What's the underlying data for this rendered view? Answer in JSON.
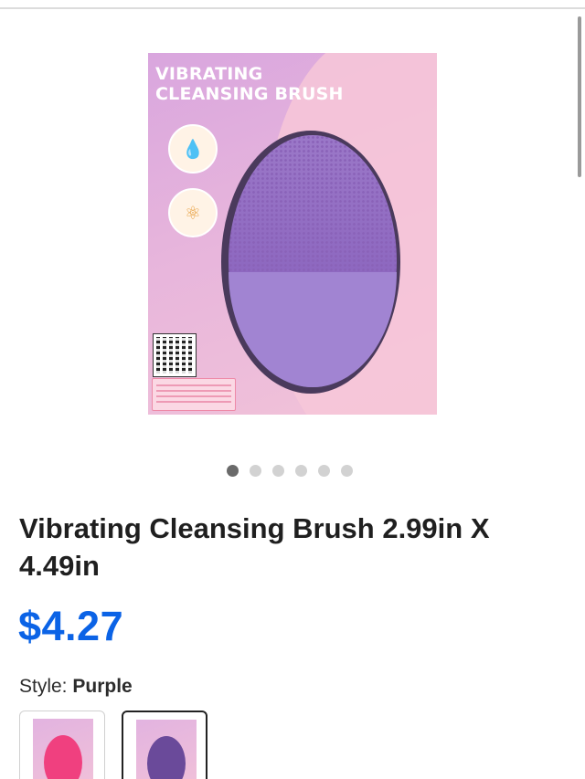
{
  "product": {
    "image_alt": "Vibrating Cleansing Brush package",
    "package_title_line1": "VIBRATING",
    "package_title_line2": "CLEANSING BRUSH",
    "title": "Vibrating Cleansing Brush 2.99in X 4.49in",
    "price": "$4.27",
    "style_label": "Style:",
    "style_value": "Purple"
  },
  "carousel": {
    "count": 6,
    "active_index": 0
  },
  "variants": [
    {
      "name": "Pink",
      "color": "#f0407f",
      "selected": false
    },
    {
      "name": "Purple",
      "color": "#6a4a9a",
      "selected": true
    }
  ],
  "colors": {
    "price": "#0b63e6",
    "active_dot": "#6a6a6a",
    "inactive_dot": "#d2d2d2"
  },
  "icons": [
    "droplet-icon",
    "face-massage-icon",
    "qr-code-icon"
  ]
}
